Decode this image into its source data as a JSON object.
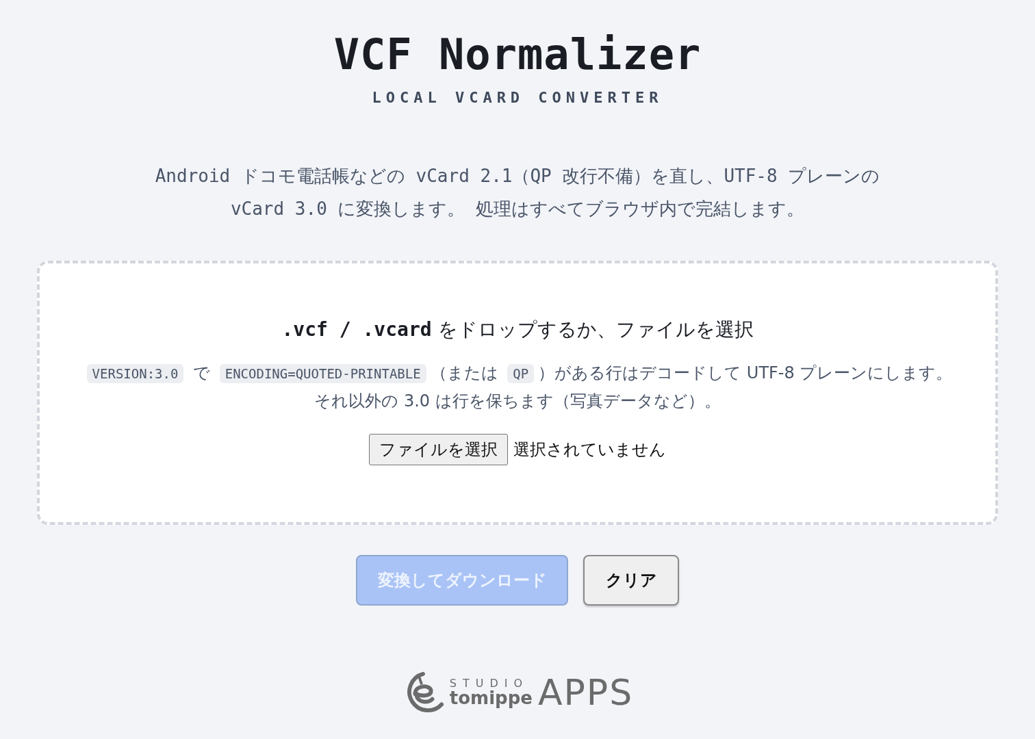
{
  "header": {
    "title": "VCF Normalizer",
    "subtitle": "LOCAL VCARD CONVERTER"
  },
  "intro": "Android ドコモ電話帳などの vCard 2.1（QP 改行不備）を直し、UTF-8 プレーンの vCard 3.0 に変換します。 処理はすべてブラウザ内で完結します。",
  "dropzone": {
    "heading": [
      {
        "kind": "code",
        "text": ".vcf / .vcard"
      },
      {
        "kind": "text",
        "text": " をドロップするか、ファイルを選択"
      }
    ],
    "hint": [
      {
        "kind": "code",
        "text": "VERSION:3.0"
      },
      {
        "kind": "text",
        "text": " で "
      },
      {
        "kind": "code",
        "text": "ENCODING=QUOTED-PRINTABLE"
      },
      {
        "kind": "text",
        "text": "（または "
      },
      {
        "kind": "code",
        "text": "QP"
      },
      {
        "kind": "text",
        "text": "）がある行はデコードして UTF-8 プレーンにします。それ以外の 3.0 は行を保ちます（写真データなど）。"
      }
    ],
    "file_button": "ファイルを選択",
    "file_status": "選択されていません"
  },
  "actions": [
    {
      "label": "変換してダウンロード",
      "kind": "primary",
      "disabled": true
    },
    {
      "label": "クリア",
      "kind": "secondary",
      "disabled": false
    }
  ],
  "footer": {
    "studio": "STUDIO",
    "brand": "tomippe",
    "apps": "APPS"
  }
}
